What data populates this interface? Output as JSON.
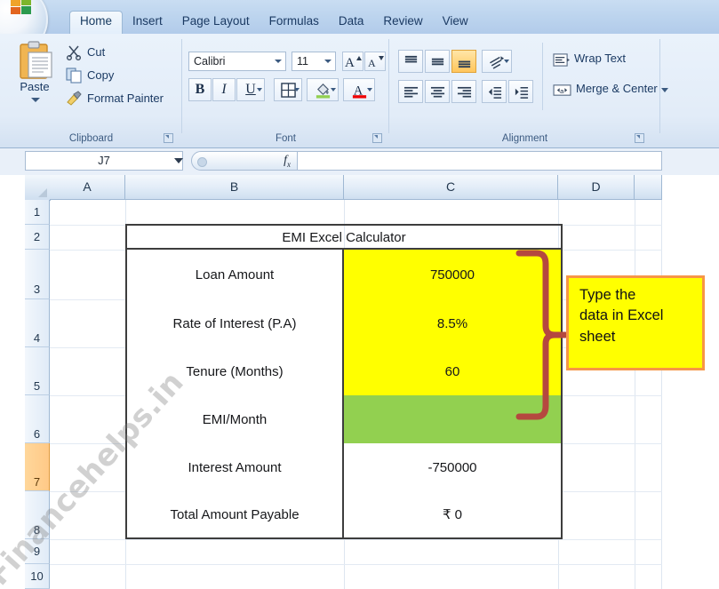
{
  "app": {
    "office_orb": "office-orb",
    "tabs": [
      {
        "label": "Home",
        "active": true
      },
      {
        "label": "Insert",
        "active": false
      },
      {
        "label": "Page Layout",
        "active": false
      },
      {
        "label": "Formulas",
        "active": false
      },
      {
        "label": "Data",
        "active": false
      },
      {
        "label": "Review",
        "active": false
      },
      {
        "label": "View",
        "active": false
      }
    ]
  },
  "ribbon": {
    "clipboard": {
      "group_label": "Clipboard",
      "paste_label": "Paste",
      "cut_label": "Cut",
      "copy_label": "Copy",
      "format_painter_label": "Format Painter"
    },
    "font": {
      "group_label": "Font",
      "font_name": "Calibri",
      "font_size": "11",
      "bold": "B",
      "italic": "I",
      "underline": "U"
    },
    "alignment": {
      "group_label": "Alignment",
      "wrap_text_label": "Wrap Text",
      "merge_center_label": "Merge & Center"
    }
  },
  "formula_bar": {
    "name_box": "J7",
    "formula": ""
  },
  "sheet": {
    "columns": [
      "A",
      "B",
      "C",
      "D"
    ],
    "rows": [
      "1",
      "2",
      "3",
      "4",
      "5",
      "6",
      "7",
      "8",
      "9",
      "10"
    ],
    "selected_row": "7",
    "selected_cell": "J7"
  },
  "emi_table": {
    "title": "EMI Excel Calculator",
    "rows": [
      {
        "label": "Loan Amount",
        "value": "750000",
        "fill": "#FFFF00"
      },
      {
        "label": "Rate of Interest (P.A)",
        "value": "8.5%",
        "fill": "#FFFF00"
      },
      {
        "label": "Tenure (Months)",
        "value": "60",
        "fill": "#FFFF00"
      },
      {
        "label": "EMI/Month",
        "value": "",
        "fill": "#92D050"
      },
      {
        "label": "Interest Amount",
        "value": "-750000",
        "fill": "#FFFFFF"
      },
      {
        "label": "Total Amount Payable",
        "value": "₹ 0",
        "fill": "#FFFFFF"
      }
    ]
  },
  "annotation": {
    "callout_text": "Type the data in Excel sheet",
    "callout_lines": [
      "Type the",
      "data in Excel",
      "sheet"
    ],
    "brace_color": "#B5483F",
    "callout_fill": "#FFFF00",
    "callout_border": "#F79646"
  },
  "watermark": {
    "text": "Financehelps.in"
  }
}
